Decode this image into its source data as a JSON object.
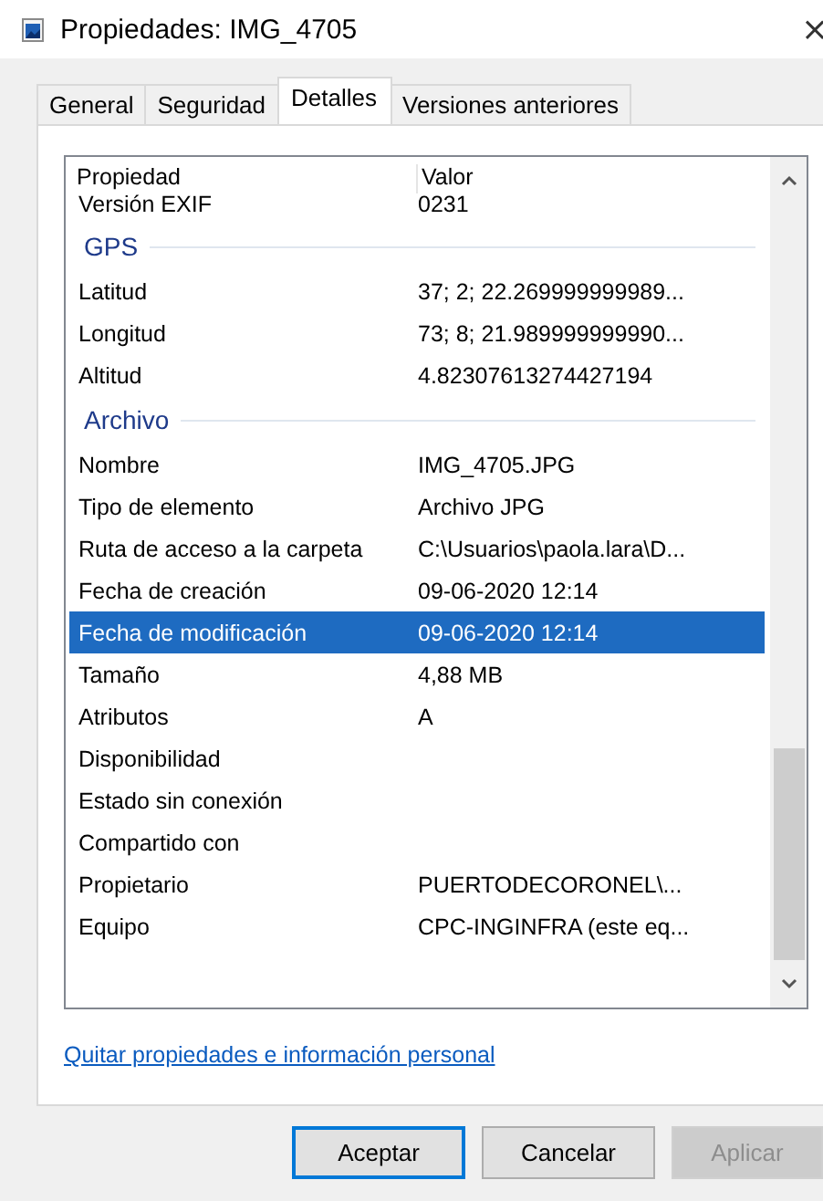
{
  "window": {
    "title": "Propiedades: IMG_4705",
    "close": "×"
  },
  "tabs": [
    {
      "label": "General",
      "selected": false
    },
    {
      "label": "Seguridad",
      "selected": false
    },
    {
      "label": "Detalles",
      "selected": true
    },
    {
      "label": "Versiones anteriores",
      "selected": false
    }
  ],
  "table": {
    "columns": [
      "Propiedad",
      "Valor"
    ],
    "rows": [
      {
        "kind": "row",
        "property": "Versión EXIF",
        "value": "0231",
        "selected": false
      },
      {
        "kind": "group",
        "label": "GPS"
      },
      {
        "kind": "row",
        "property": "Latitud",
        "value": "37; 2; 22.269999999989...",
        "selected": false
      },
      {
        "kind": "row",
        "property": "Longitud",
        "value": "73; 8; 21.989999999990...",
        "selected": false
      },
      {
        "kind": "row",
        "property": "Altitud",
        "value": "4.82307613274427194",
        "selected": false
      },
      {
        "kind": "group",
        "label": "Archivo"
      },
      {
        "kind": "row",
        "property": "Nombre",
        "value": "IMG_4705.JPG",
        "selected": false
      },
      {
        "kind": "row",
        "property": "Tipo de elemento",
        "value": "Archivo JPG",
        "selected": false
      },
      {
        "kind": "row",
        "property": "Ruta de acceso a la carpeta",
        "value": "C:\\Usuarios\\paola.lara\\D...",
        "selected": false
      },
      {
        "kind": "row",
        "property": "Fecha de creación",
        "value": "09-06-2020 12:14",
        "selected": false
      },
      {
        "kind": "row",
        "property": "Fecha de modificación",
        "value": "09-06-2020 12:14",
        "selected": true
      },
      {
        "kind": "row",
        "property": "Tamaño",
        "value": "4,88 MB",
        "selected": false
      },
      {
        "kind": "row",
        "property": "Atributos",
        "value": "A",
        "selected": false
      },
      {
        "kind": "row",
        "property": "Disponibilidad",
        "selected": false
      },
      {
        "kind": "row",
        "property": "Estado sin conexión",
        "selected": false
      },
      {
        "kind": "row",
        "property": "Compartido con",
        "selected": false
      },
      {
        "kind": "row",
        "property": "Propietario",
        "value": "PUERTODECORONEL\\...",
        "selected": false
      },
      {
        "kind": "row",
        "property": "Equipo",
        "value": "CPC-INGINFRA (este eq...",
        "selected": false
      }
    ]
  },
  "link": "Quitar propiedades e información personal",
  "buttons": [
    {
      "label": "Aceptar",
      "default": true,
      "disabled": false
    },
    {
      "label": "Cancelar",
      "default": false,
      "disabled": false
    },
    {
      "label": "Aplicar",
      "default": false,
      "disabled": true
    }
  ]
}
